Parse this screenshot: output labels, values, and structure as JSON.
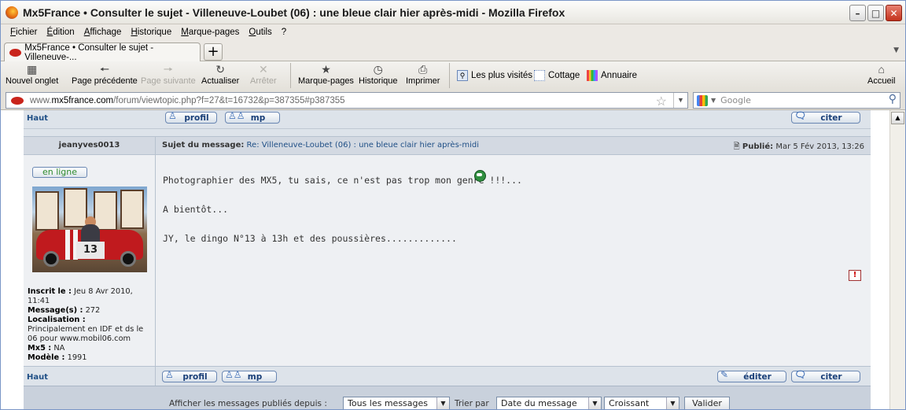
{
  "window": {
    "title": "Mx5France • Consulter le sujet - Villeneuve-Loubet (06) : une bleue clair hier après-midi - Mozilla Firefox"
  },
  "menu": [
    "Fichier",
    "Édition",
    "Affichage",
    "Historique",
    "Marque-pages",
    "Outils",
    "?"
  ],
  "tab": {
    "label": "Mx5France • Consulter le sujet - Villeneuve-...",
    "new_tab": "+"
  },
  "toolbar": {
    "new_tab": "Nouvel onglet",
    "back": "Page précédente",
    "forward": "Page suivante",
    "reload": "Actualiser",
    "stop": "Arrêter",
    "bookmarks": "Marque-pages",
    "history": "Historique",
    "print": "Imprimer",
    "most_visited": "Les plus visités",
    "cottage": "Cottage",
    "annuaire": "Annuaire",
    "home": "Accueil"
  },
  "address": {
    "url_prefix": "www.",
    "url_domain": "mx5france.com",
    "url_path": "/forum/viewtopic.php?f=27&t=16732&p=387355#p387355"
  },
  "search": {
    "placeholder": "Google"
  },
  "forum": {
    "top_row": {
      "haut": "Haut",
      "profil": "profil",
      "mp": "mp",
      "citer": "citer"
    },
    "header": {
      "author": "jeanyves0013",
      "subject_label": "Sujet du message:",
      "subject": "Re: Villeneuve-Loubet (06) : une bleue clair hier après-midi",
      "published_label": "Publié:",
      "published": "Mar 5 Fév 2013, 13:26"
    },
    "online": "en ligne",
    "info": {
      "inscrit_label": "Inscrit le :",
      "inscrit": "Jeu 8 Avr 2010, 11:41",
      "messages_label": "Message(s) :",
      "messages": "272",
      "localisation_label": "Localisation :",
      "localisation": "Principalement en IDF et ds le 06 pour www.mobil06.com",
      "mx5_label": "Mx5 :",
      "mx5": "NA",
      "modele_label": "Modèle :",
      "modele": "1991"
    },
    "avatar_sign": "13",
    "post": {
      "line1": "Photographier des MX5, tu sais, ce n'est pas trop mon genre !!!...",
      "line2": "A bientôt...",
      "line3": "JY, le dingo N°13 à 13h et des poussières............."
    },
    "report": "!",
    "bottom_row": {
      "haut": "Haut",
      "profil": "profil",
      "mp": "mp",
      "editer": "éditer",
      "citer": "citer"
    },
    "filter": {
      "label": "Afficher les messages publiés depuis :",
      "since": "Tous les messages",
      "sort_label": "Trier par",
      "sort_by": "Date du message",
      "order": "Croissant",
      "submit": "Valider"
    }
  }
}
